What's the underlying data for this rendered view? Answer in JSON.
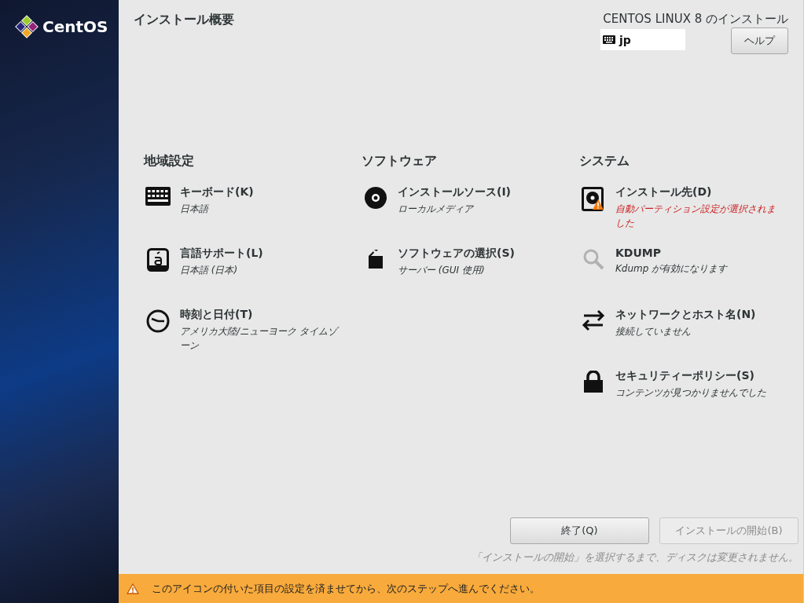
{
  "brand": {
    "logo_text": "CentOS"
  },
  "header": {
    "title": "インストール概要",
    "product": "CENTOS LINUX 8 のインストール",
    "keyboard_layout": "jp",
    "help_button": "ヘルプ"
  },
  "sections": [
    {
      "title": "地域設定",
      "spokes": [
        {
          "kind": "keyboard",
          "title": "キーボード(K)",
          "status": "日本語",
          "warning": false,
          "inactive": false
        },
        {
          "kind": "language",
          "title": "言語サポート(L)",
          "status": "日本語 (日本)",
          "warning": false,
          "inactive": false
        },
        {
          "kind": "clock",
          "title": "時刻と日付(T)",
          "status": "アメリカ大陸/ニューヨーク タイムゾーン",
          "warning": false,
          "inactive": false
        }
      ]
    },
    {
      "title": "ソフトウェア",
      "spokes": [
        {
          "kind": "disc",
          "title": "インストールソース(I)",
          "status": "ローカルメディア",
          "warning": false,
          "inactive": false
        },
        {
          "kind": "package",
          "title": "ソフトウェアの選択(S)",
          "status": "サーバー (GUI 使用)",
          "warning": false,
          "inactive": false
        }
      ]
    },
    {
      "title": "システム",
      "spokes": [
        {
          "kind": "disk",
          "title": "インストール先(D)",
          "status": "自動パーティション設定が選択されました",
          "warning": true,
          "inactive": false
        },
        {
          "kind": "search",
          "title": "KDUMP",
          "status": "Kdump が有効になります",
          "warning": false,
          "inactive": true
        },
        {
          "kind": "arrows",
          "title": "ネットワークとホスト名(N)",
          "status": "接続していません",
          "warning": false,
          "inactive": false
        },
        {
          "kind": "lock",
          "title": "セキュリティーポリシー(S)",
          "status": "コンテンツが見つかりませんでした",
          "warning": false,
          "inactive": false
        }
      ]
    }
  ],
  "buttons": [
    {
      "label": "終了(Q)",
      "disabled": false
    },
    {
      "label": "インストールの開始(B)",
      "disabled": true
    }
  ],
  "note": "「インストールの開始」を選択するまで、ディスクは変更されません。",
  "warning_bar": "このアイコンの付いた項目の設定を済ませてから、次のステップへ進んでください。"
}
